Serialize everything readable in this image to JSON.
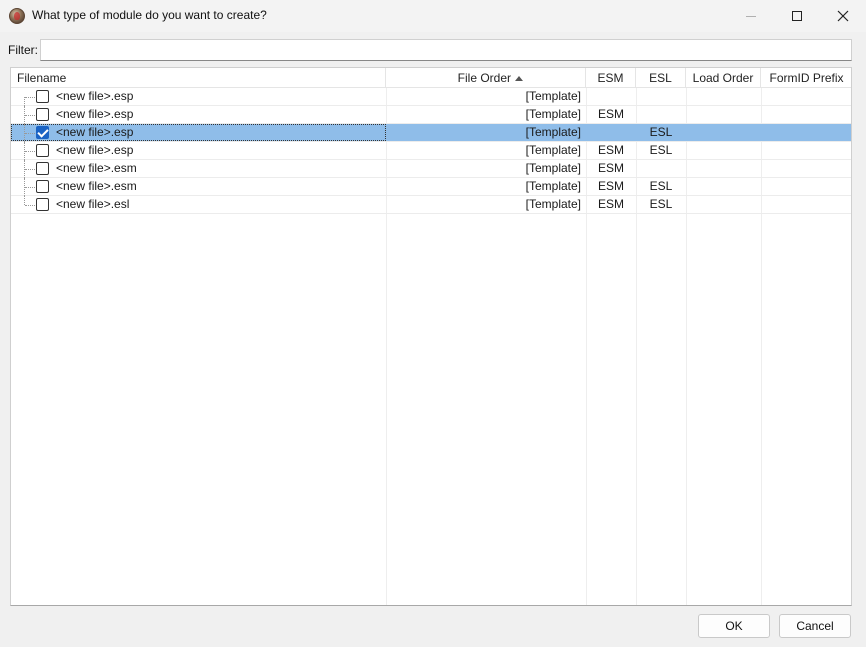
{
  "window": {
    "title": "What type of module do you want to create?",
    "icon": "skyrim-app-icon",
    "controls": [
      "minimize-icon",
      "maximize-icon",
      "close-icon"
    ]
  },
  "filter": {
    "label": "Filter:",
    "value": "",
    "placeholder": ""
  },
  "table": {
    "columns": [
      "Filename",
      "File Order",
      "ESM",
      "ESL",
      "Load Order",
      "FormID Prefix"
    ],
    "sort_column": "File Order",
    "sort_direction": "ascending",
    "rows": [
      {
        "checked": false,
        "filename": "<new file>.esp",
        "file_order": "[Template]",
        "esm": "",
        "esl": "",
        "load_order": "",
        "formid_prefix": ""
      },
      {
        "checked": false,
        "filename": "<new file>.esp",
        "file_order": "[Template]",
        "esm": "ESM",
        "esl": "",
        "load_order": "",
        "formid_prefix": ""
      },
      {
        "checked": true,
        "filename": "<new file>.esp",
        "file_order": "[Template]",
        "esm": "",
        "esl": "ESL",
        "load_order": "",
        "formid_prefix": "",
        "selected": true
      },
      {
        "checked": false,
        "filename": "<new file>.esp",
        "file_order": "[Template]",
        "esm": "ESM",
        "esl": "ESL",
        "load_order": "",
        "formid_prefix": ""
      },
      {
        "checked": false,
        "filename": "<new file>.esm",
        "file_order": "[Template]",
        "esm": "ESM",
        "esl": "",
        "load_order": "",
        "formid_prefix": ""
      },
      {
        "checked": false,
        "filename": "<new file>.esm",
        "file_order": "[Template]",
        "esm": "ESM",
        "esl": "ESL",
        "load_order": "",
        "formid_prefix": ""
      },
      {
        "checked": false,
        "filename": "<new file>.esl",
        "file_order": "[Template]",
        "esm": "ESM",
        "esl": "ESL",
        "load_order": "",
        "formid_prefix": ""
      }
    ]
  },
  "buttons": {
    "ok": "OK",
    "cancel": "Cancel"
  },
  "colors": {
    "selection": "#8fbde9",
    "checkbox_checked": "#1a63c4"
  }
}
